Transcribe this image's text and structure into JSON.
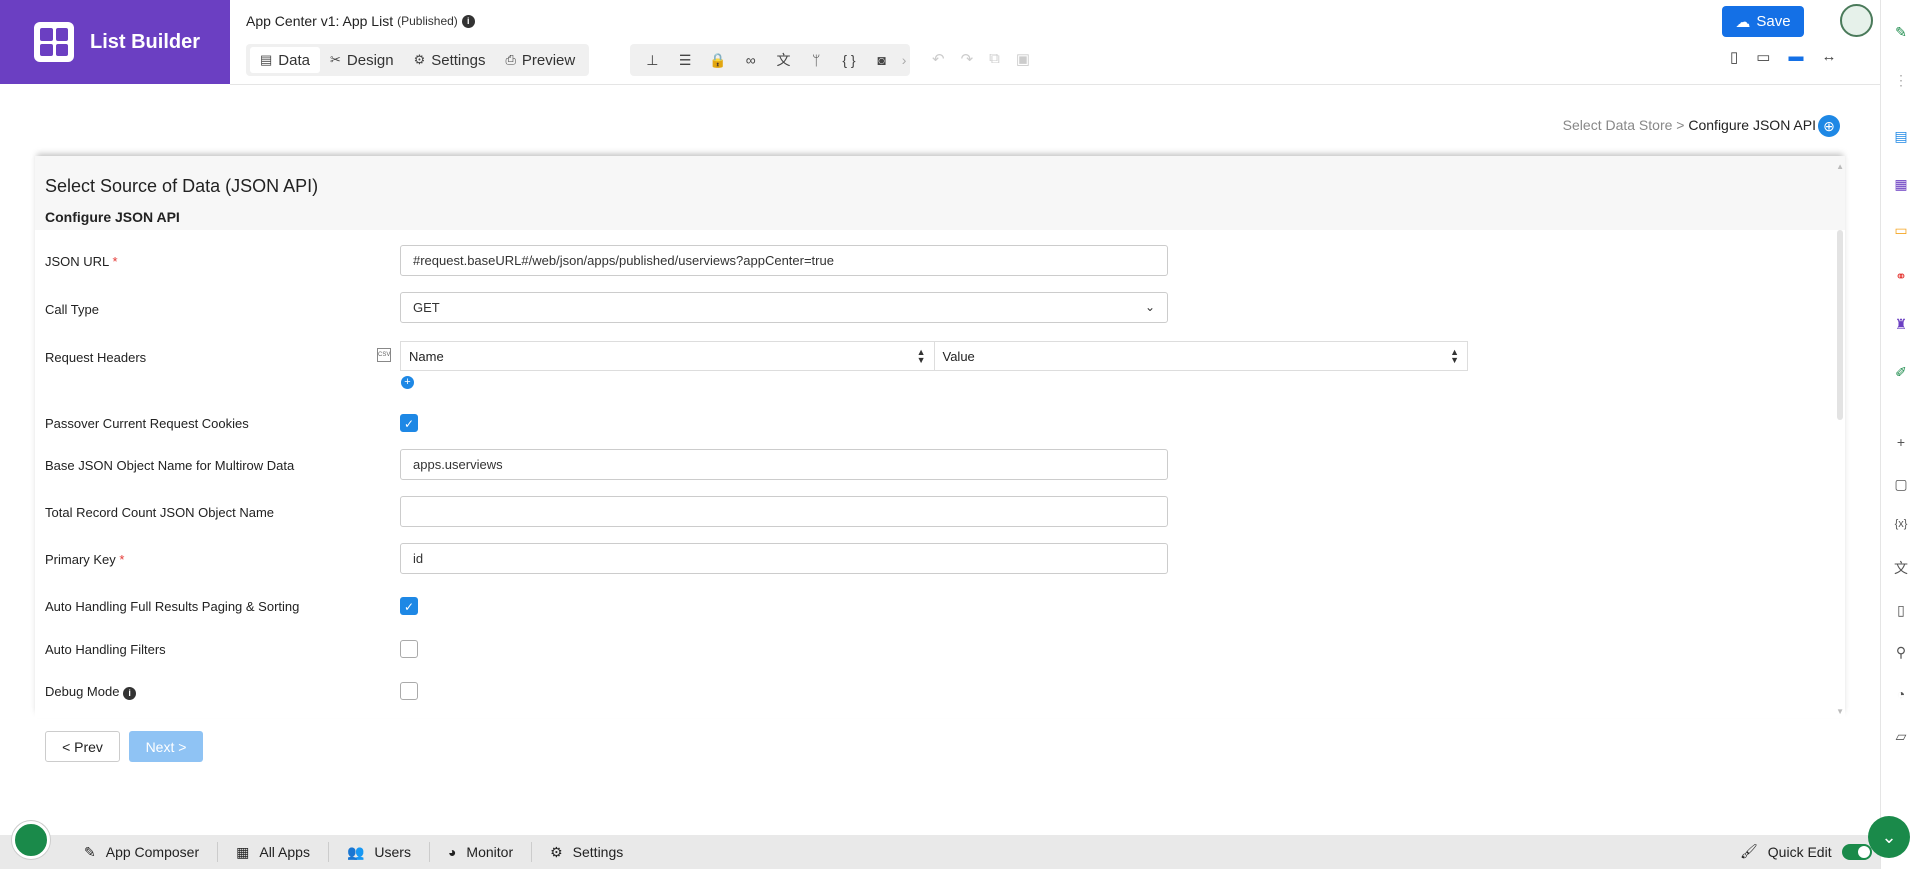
{
  "brand": {
    "title": "List Builder"
  },
  "app": {
    "title": "App Center v1: App List",
    "status": "(Published)"
  },
  "tabs": [
    {
      "label": "Data",
      "icon": "table-icon"
    },
    {
      "label": "Design",
      "icon": "tools-icon"
    },
    {
      "label": "Settings",
      "icon": "gear-icon"
    },
    {
      "label": "Preview",
      "icon": "preview-icon"
    }
  ],
  "toolbar": {
    "save_label": "Save"
  },
  "breadcrumb": {
    "parent": "Select Data Store",
    "separator": ">",
    "current": "Configure JSON API"
  },
  "panel": {
    "title": "Select Source of Data (JSON API)",
    "subtitle": "Configure JSON API"
  },
  "form": {
    "json_url": {
      "label": "JSON URL",
      "required": "*",
      "value": "#request.baseURL#/web/json/apps/published/userviews?appCenter=true"
    },
    "call_type": {
      "label": "Call Type",
      "value": "GET"
    },
    "request_headers": {
      "label": "Request Headers",
      "col_name": "Name",
      "col_value": "Value"
    },
    "passover_cookies": {
      "label": "Passover Current Request Cookies",
      "checked": true
    },
    "base_json": {
      "label": "Base JSON Object Name for Multirow Data",
      "value": "apps.userviews"
    },
    "total_count": {
      "label": "Total Record Count JSON Object Name",
      "value": ""
    },
    "primary_key": {
      "label": "Primary Key",
      "required": "*",
      "value": "id"
    },
    "auto_paging": {
      "label": "Auto Handling Full Results Paging & Sorting",
      "checked": true
    },
    "auto_filters": {
      "label": "Auto Handling Filters",
      "checked": false
    },
    "debug_mode": {
      "label": "Debug Mode",
      "checked": false
    }
  },
  "nav": {
    "prev_label": "< Prev",
    "next_label": "Next >"
  },
  "bottombar": {
    "items": [
      {
        "label": "App Composer",
        "icon": "edit-icon"
      },
      {
        "label": "All Apps",
        "icon": "grid-icon"
      },
      {
        "label": "Users",
        "icon": "users-icon"
      },
      {
        "label": "Monitor",
        "icon": "gauge-icon"
      },
      {
        "label": "Settings",
        "icon": "gears-icon"
      }
    ],
    "quick_edit_label": "Quick Edit"
  },
  "colors": {
    "brand": "#6b3fc2",
    "primary": "#1470e6",
    "accent_green": "#1a8a4a"
  }
}
